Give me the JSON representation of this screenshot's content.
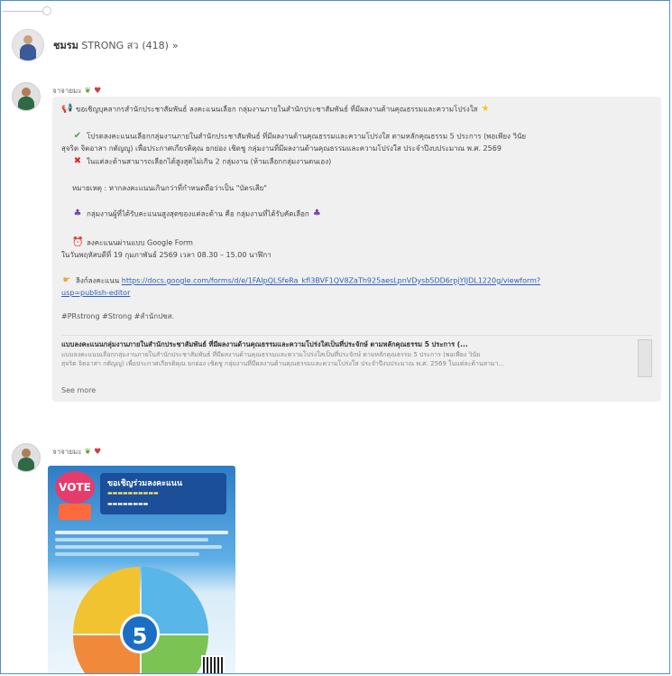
{
  "group": {
    "name_bold": "ชมรม",
    "name_main": " STRONG สว",
    "member_count": "(418)"
  },
  "posts": [
    {
      "sender": "จาจายมะ",
      "lines": [
        "ขอเชิญบุคลากรสำนักประชาสัมพันธ์ ลงคะแนนเลือก กลุ่มงานภายในสำนักประชาสัมพันธ์ ที่มีผลงานด้านคุณธรรมและความโปร่งใส",
        "โปรดลงคะแนนเลือกกลุ่มงานภายในสำนักประชาสัมพันธ์ ที่มีผลงานด้านคุณธรรมและความโปร่งใส ตามหลักคุณธรรม 5 ประการ (พอเพียง วินัย",
        "สุจริต จิตอาสา กตัญญู) เพื่อประกาศเกียรติคุณ ยกย่อง เชิดชู กลุ่มงานที่มีผลงานด้านคุณธรรมและความโปร่งใส ประจำปีงบประมาณ พ.ศ. 2569",
        "ในแต่ละด้านสามารถเลือกได้สูงสุดไม่เกิน 2 กลุ่มงาน (ห้ามเลือกกลุ่มงานตนเอง)",
        "หมายเหตุ : หากลงคะแนนเกินกว่าที่กำหนดถือว่าเป็น \"บัตรเสีย\"",
        "กลุ่มงานผู้ที่ได้รับคะแนนสูงสุดของแต่ละด้าน คือ กลุ่มงานที่ได้รับคัดเลือก",
        "ลงคะแนนผ่านแบบ Google Form",
        "ในวันพฤหัสบดีที่ 19 กุมภาพันธ์ 2569 เวลา 08.30 – 15.00 นาฬิกา",
        "ลิงก์ลงคะแนน"
      ],
      "link_text": "https://docs.google.com/forms/d/e/1FAIpQLSfeRa_kfl3BVF1QV8ZaTh925aesLpnVDysb5DD6rpjYIJDL1220g/viewform?usp=publish-editor",
      "link_text_short_1": "https://docs.google.com/forms/d/e/1FAIpQLSfeRa_kfl3BVF1QV8ZaTh925aesLpnVDysb5DD6rpjYIJDL1220g/viewform?",
      "link_text_short_2": "usp=publish-editor",
      "hashtags": "#PRstrong #Strong #สำนักปชส.",
      "preview_title": "แบบลงคะแนนกลุ่มงานภายในสำนักประชาสัมพันธ์ ที่มีผลงานด้านคุณธรรมและความโปร่งใสเป็นที่ประจักษ์ ตามหลักคุณธรรม 5 ประการ (...",
      "preview_desc_1": "แบบลงคะแนนเลือกกลุ่มงานภายในสำนักประชาสัมพันธ์ ที่มีผลงานด้านคุณธรรมและความโปร่งใสเป็นที่ประจักษ์ ตามหลักคุณธรรม 5 ประการ (พอเพียง วินัย",
      "preview_desc_2": "สุจริต จิตอาสา กตัญญู) เพื่อประกาศเกียรติคุณ ยกย่อง เชิดชู กลุ่มงานที่มีผลงานด้านคุณธรรมและความโปร่งใส ประจำปีงบประมาณ พ.ศ. 2569 ในแต่ละด้านสามา...",
      "see_more": "See more"
    },
    {
      "sender": "จาจายมะ",
      "poster_title": "ขอเชิญร่วมลงคะแนน",
      "poster_badge": "VOTE",
      "poster_number": "5"
    }
  ],
  "colors": {
    "link": "#2a5fb8",
    "frame_border": "#4a90d9",
    "bubble_bg": "#f0f0f0"
  }
}
